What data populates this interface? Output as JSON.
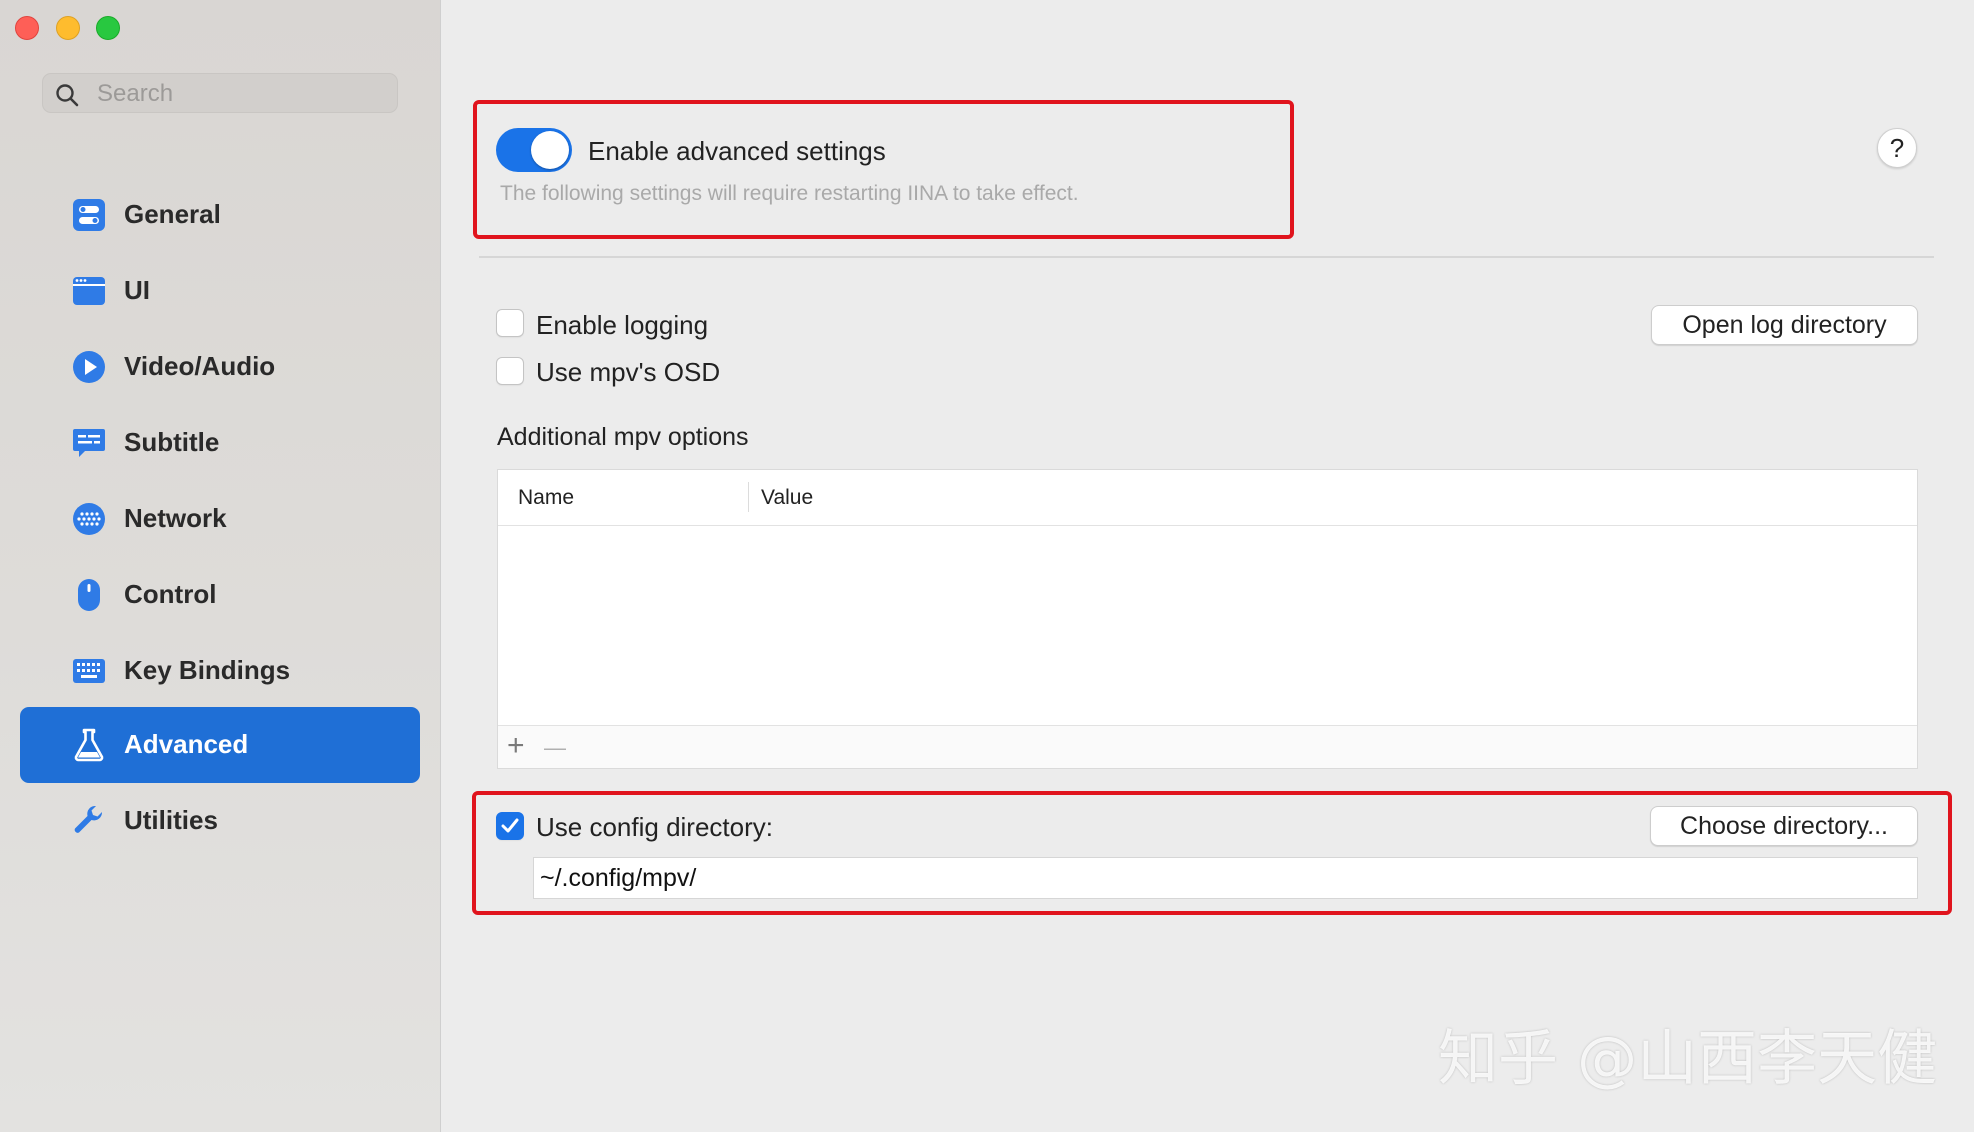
{
  "sidebar": {
    "search_placeholder": "Search",
    "items": [
      {
        "label": "General",
        "icon": "general-icon"
      },
      {
        "label": "UI",
        "icon": "ui-icon"
      },
      {
        "label": "Video/Audio",
        "icon": "video-audio-icon"
      },
      {
        "label": "Subtitle",
        "icon": "subtitle-icon"
      },
      {
        "label": "Network",
        "icon": "network-icon"
      },
      {
        "label": "Control",
        "icon": "control-icon"
      },
      {
        "label": "Key Bindings",
        "icon": "key-bindings-icon"
      },
      {
        "label": "Advanced",
        "icon": "advanced-icon",
        "active": true
      },
      {
        "label": "Utilities",
        "icon": "utilities-icon"
      }
    ]
  },
  "advanced": {
    "enable_label": "Enable advanced settings",
    "enable_on": true,
    "hint": "The following settings will require restarting IINA to take effect.",
    "help_label": "?",
    "enable_logging_label": "Enable logging",
    "enable_logging_checked": false,
    "open_log_label": "Open log directory",
    "use_osd_label": "Use mpv's OSD",
    "use_osd_checked": false,
    "mpv_options_label": "Additional mpv options",
    "table": {
      "columns": [
        "Name",
        "Value"
      ],
      "rows": [],
      "add_label": "+",
      "remove_label": "—"
    },
    "use_config_label": "Use config directory:",
    "use_config_checked": true,
    "choose_dir_label": "Choose directory...",
    "config_path": "~/.config/mpv/"
  },
  "watermark": "知乎 @山西李天健",
  "colors": {
    "accent": "#1a73e8",
    "sidebar_active": "#1f6fd6",
    "highlight_box": "#e0141d"
  }
}
